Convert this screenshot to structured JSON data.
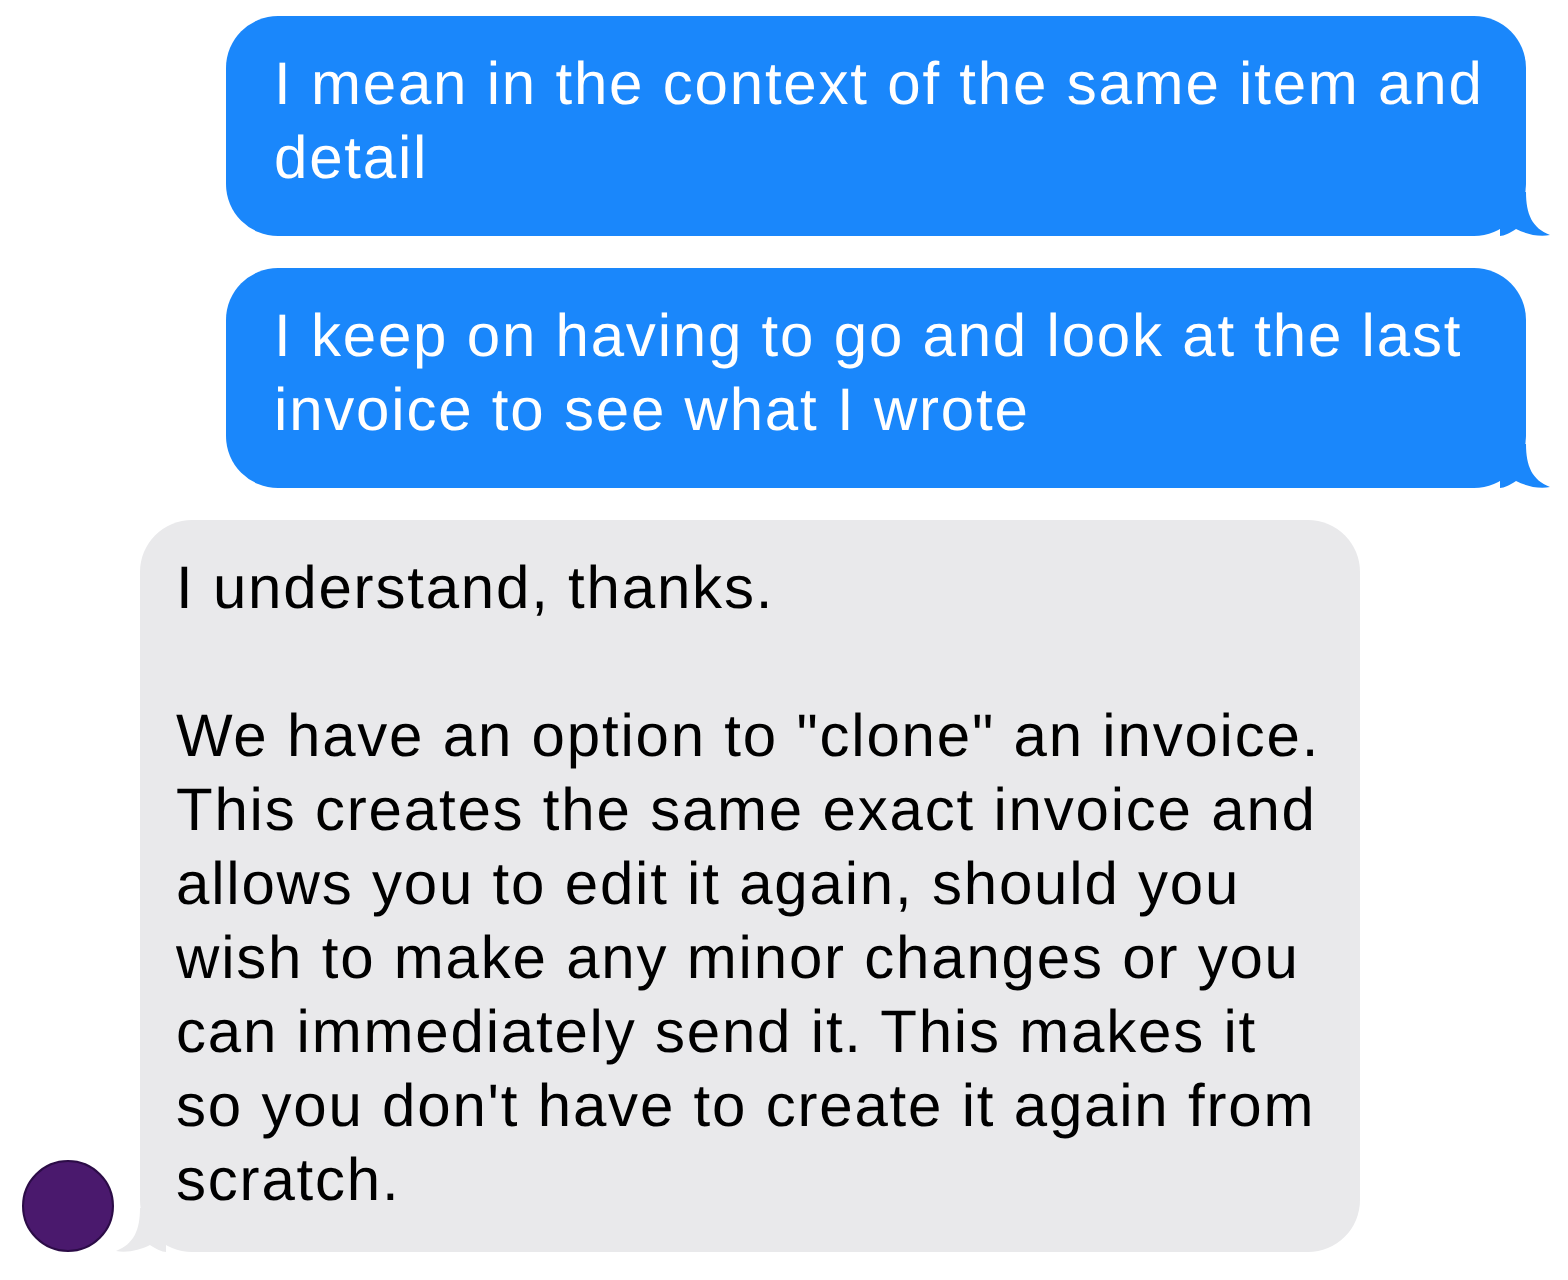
{
  "messages": [
    {
      "kind": "sent",
      "paragraphs": [
        "I mean in the context of the same item and detail"
      ]
    },
    {
      "kind": "sent",
      "paragraphs": [
        "I keep on having to go and look at the last invoice to see what I wrote"
      ]
    },
    {
      "kind": "received",
      "paragraphs": [
        "I understand, thanks.",
        "We have an option to \"clone\" an invoice. This creates the same exact invoice and allows you to edit it again, should you wish to make any minor changes or you can immediately send it. This makes it so you don't have to create it again from scratch."
      ]
    }
  ]
}
